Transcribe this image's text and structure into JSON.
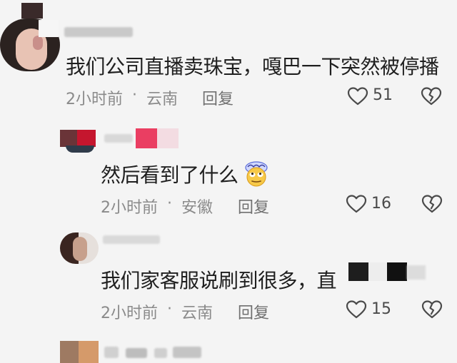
{
  "comments": [
    {
      "text": "我们公司直播卖珠宝，嘎巴一下突然被停播",
      "time": "2小时前",
      "separator": "·",
      "location": "云南",
      "reply_label": "回复",
      "likes": "51"
    },
    {
      "text": "然后看到了什么",
      "emoji": "rolling-eyes-brain-emoji",
      "time": "2小时前",
      "separator": "·",
      "location": "安徽",
      "reply_label": "回复",
      "likes": "16"
    },
    {
      "text": "我们家客服说刷到很多，直",
      "time": "2小时前",
      "separator": "·",
      "location": "云南",
      "reply_label": "回复",
      "likes": "15"
    }
  ],
  "colors": {
    "background": "#f4f4f4",
    "text": "#1f1f1f",
    "meta": "#8a8a8a"
  }
}
